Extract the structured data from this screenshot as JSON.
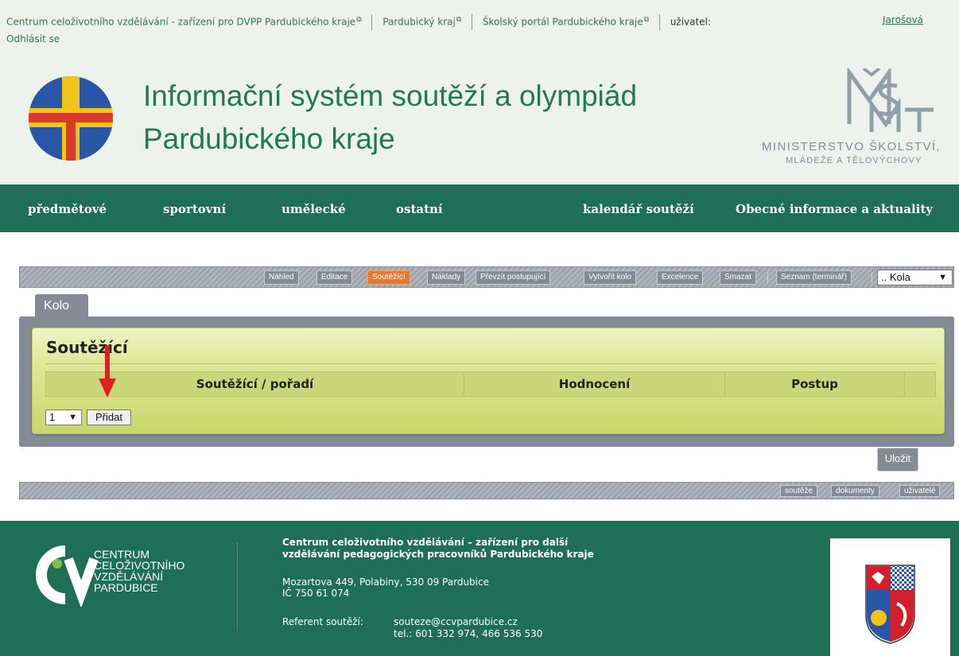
{
  "topbar": {
    "link_ccv": "Centrum celoživotního vzdělávání - zařízení pro DVPP Pardubického kraje",
    "link_kraj": "Pardubický kraj",
    "link_portal": "Školský portál Pardubického kraje",
    "user_label": "uživatel:",
    "user_name": "Jarošová",
    "logout": "Odhlásit se",
    "external_icon": "external-link-icon"
  },
  "header": {
    "title_line1": "Informační systém soutěží a olympiád",
    "title_line2": "Pardubického kraje",
    "msmt_line1": "MINISTERSTVO ŠKOLSTVÍ,",
    "msmt_line2": "MLÁDEŽE A TĚLOVÝCHOVY"
  },
  "nav": {
    "predmetove": "předmětové",
    "sportovni": "sportovní",
    "umelecke": "umělecké",
    "ostatni": "ostatní",
    "kalendar": "kalendář soutěží",
    "obecne": "Obecné informace a aktuality"
  },
  "toolbar": {
    "nahled": "Náhled",
    "editace": "Editace",
    "soutezici": "Soutěžící",
    "naklady": "Náklady",
    "prevzit": "Převzít postupující",
    "vytvorit": "Vytvořit kolo",
    "excelence": "Excelence",
    "smazat": "Smazat",
    "seznam": "Seznam (terminář)",
    "kola_select": ".. Kola"
  },
  "tab": {
    "kolo": "Kolo"
  },
  "panel": {
    "heading": "Soutěžící",
    "col_soutezici": "Soutěžící / pořadí",
    "col_hodnoceni": "Hodnocení",
    "col_postup": "Postup",
    "num_select": "1",
    "add_button": "Přidat",
    "save_button": "Uložit"
  },
  "bottombar": {
    "souteze": "soutěže",
    "dokumenty": "dokumenty",
    "uzivatele": "uživatelé"
  },
  "footer": {
    "ccv_line1": "CENTRUM",
    "ccv_line2": "CELOŽIVOTNÍHO",
    "ccv_line3": "VZDĚLÁVÁNÍ",
    "ccv_line4": "PARDUBICE",
    "org_line1": "Centrum celoživotního vzdělávání – zařízení pro další",
    "org_line2": "vzdělávání pedagogických pracovníků Pardubického kraje",
    "addr_line1": "Mozartova 449, Polabiny, 530 09 Pardubice",
    "addr_line2": "IČ 750 61 074",
    "ref_label": "Referent soutěží:",
    "ref_email": "souteze@ccvpardubice.cz",
    "ref_tel": "tel.: 601 332 974, 466 536 530"
  },
  "colors": {
    "brand_green": "#1f6e56",
    "title_green": "#1f7a55",
    "active_orange": "#e8762b",
    "panel_gray": "#848b92",
    "panel_olive": "#e0ea9a",
    "arrow_red": "#e02020"
  }
}
